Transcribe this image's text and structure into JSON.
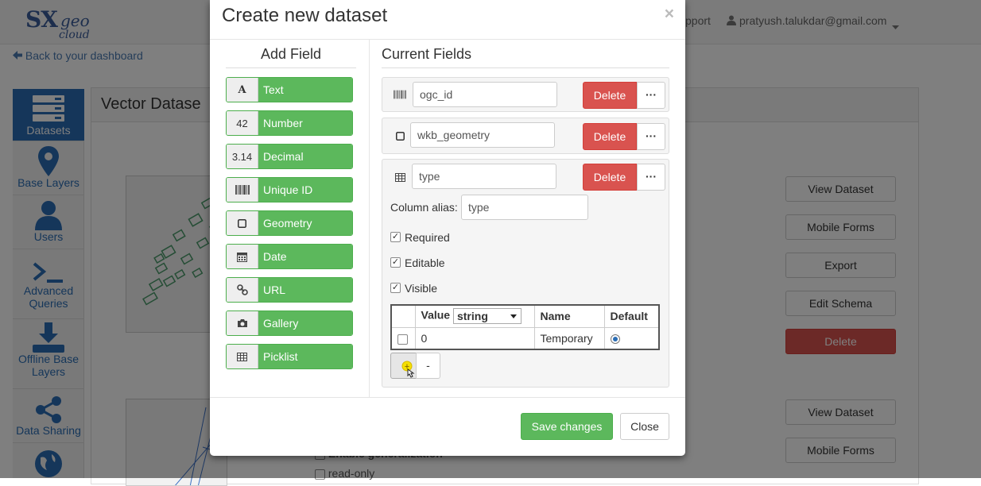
{
  "topnav": {
    "logo_sx": "SX",
    "logo_geo": "geo",
    "logo_cloud": "cloud",
    "support_label": "pport",
    "user_email": "pratyush.talukdar@gmail.com",
    "user_icon": "user-icon",
    "caret_icon": "caret-down-icon"
  },
  "back_link": "Back to your dashboard",
  "sidebar": {
    "items": [
      {
        "label": "Datasets",
        "icon": "datasets-icon"
      },
      {
        "label": "Base Layers",
        "icon": "map-marker-icon"
      },
      {
        "label": "Users",
        "icon": "user-icon"
      },
      {
        "label": "Advanced Queries",
        "icon": "terminal-icon"
      },
      {
        "label": "Offline Base Layers",
        "icon": "download-icon"
      },
      {
        "label": "Data Sharing",
        "icon": "share-icon"
      },
      {
        "label": "",
        "icon": "globe-icon"
      }
    ]
  },
  "panel": {
    "title": "Vector Datase",
    "buttons": [
      "View Dataset",
      "Mobile Forms",
      "Export",
      "Edit Schema",
      "Delete"
    ],
    "buttons2": [
      "View Dataset",
      "Mobile Forms"
    ],
    "bottom_text_1": "Enable generalization",
    "bottom_text_2": "read-only"
  },
  "modal": {
    "title": "Create new dataset",
    "close_glyph": "×",
    "add_field_title": "Add Field",
    "current_fields_title": "Current Fields",
    "add_buttons": [
      {
        "icon_text": "A",
        "icon": "text-icon",
        "label": "Text"
      },
      {
        "icon_text": "42",
        "icon": "number-icon",
        "label": "Number"
      },
      {
        "icon_text": "3.14",
        "icon": "decimal-icon",
        "label": "Decimal"
      },
      {
        "icon_text": "",
        "icon": "barcode-icon",
        "label": "Unique ID"
      },
      {
        "icon_text": "",
        "icon": "square-icon",
        "label": "Geometry"
      },
      {
        "icon_text": "",
        "icon": "calendar-icon",
        "label": "Date"
      },
      {
        "icon_text": "",
        "icon": "link-icon",
        "label": "URL"
      },
      {
        "icon_text": "",
        "icon": "camera-icon",
        "label": "Gallery"
      },
      {
        "icon_text": "",
        "icon": "table-icon",
        "label": "Picklist"
      }
    ],
    "fields": [
      {
        "name": "ogc_id",
        "icon": "barcode-icon",
        "delete_label": "Delete",
        "more_label": "···"
      },
      {
        "name": "wkb_geometry",
        "icon": "square-icon",
        "delete_label": "Delete",
        "more_label": "···"
      },
      {
        "name": "type",
        "icon": "table-icon",
        "delete_label": "Delete",
        "more_label": "···"
      }
    ],
    "expanded": {
      "alias_label": "Column alias:",
      "alias_value": "type",
      "required_label": "Required",
      "required_checked": true,
      "editable_label": "Editable",
      "editable_checked": true,
      "visible_label": "Visible",
      "visible_checked": true,
      "picklist": {
        "headers": [
          "Value",
          "Name",
          "Default"
        ],
        "type_select": "string",
        "rows": [
          {
            "checked": false,
            "value": "0",
            "name": "Temporary",
            "default": true
          }
        ]
      },
      "add_row_label": "+",
      "remove_row_label": "-"
    },
    "save_label": "Save changes",
    "close_label": "Close"
  }
}
